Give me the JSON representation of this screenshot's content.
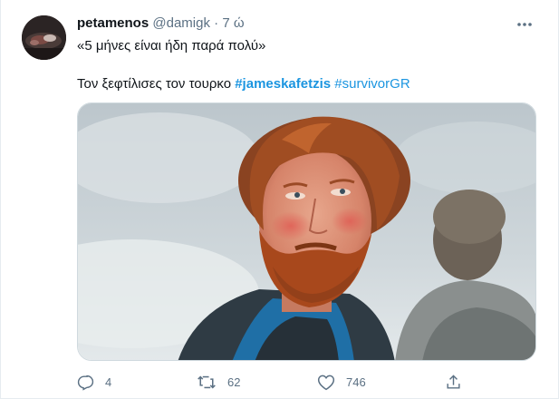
{
  "tweet": {
    "display_name": "petamenos",
    "handle": "@damigk",
    "separator": "·",
    "time": "7 ώ",
    "line1": "«5 μήνες είναι ήδη παρά πολύ»",
    "line2_text": "Τον ξεφτίλισες τον τουρκο",
    "hashtag1": "#jameskafetzis",
    "hashtag2": "#survivorGR"
  },
  "actions": {
    "reply_count": "4",
    "retweet_count": "62",
    "like_count": "746"
  },
  "icons": {
    "more": "more-dots-icon",
    "reply": "reply-icon",
    "retweet": "retweet-icon",
    "like": "heart-icon",
    "share": "share-icon"
  },
  "colors": {
    "link": "#1b95e0",
    "secondary_text": "#5b7083",
    "primary_text": "#0f1419"
  }
}
